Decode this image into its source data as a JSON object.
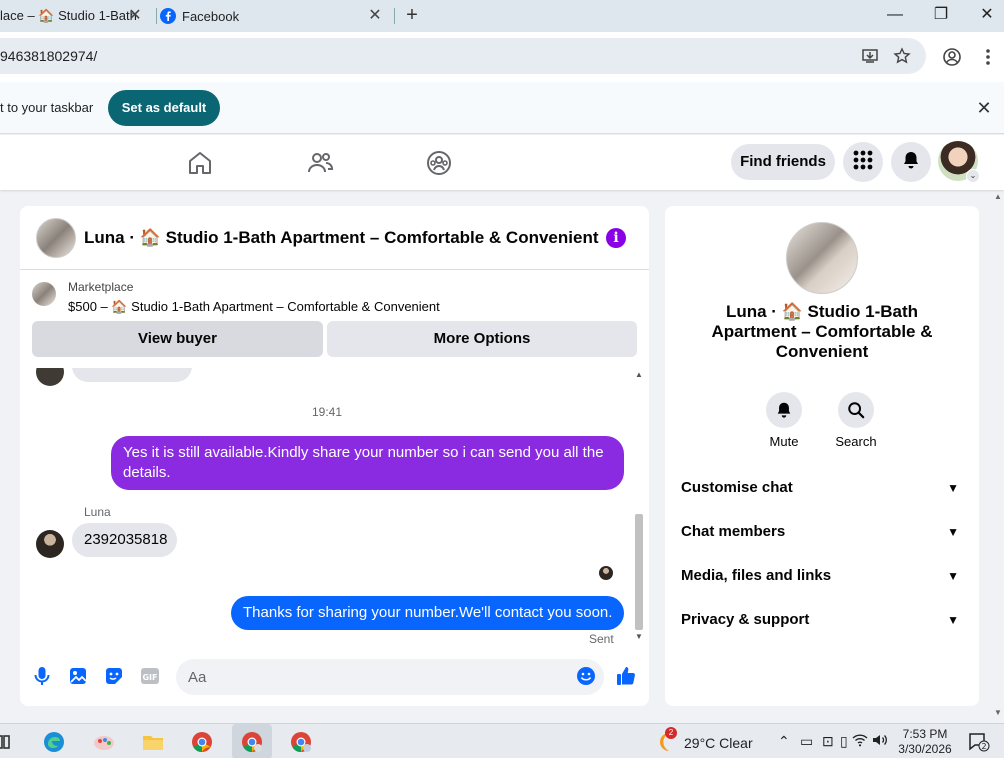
{
  "browser": {
    "tabs": [
      {
        "title": "lace – 🏠 Studio 1-Bath",
        "close": "✕"
      },
      {
        "title": "Facebook",
        "close": "✕"
      }
    ],
    "new_tab": "+",
    "url": "946381802974/"
  },
  "infobar": {
    "text": "t to your taskbar",
    "button": "Set as default",
    "close": "✕"
  },
  "nav": {
    "find_friends": "Find friends"
  },
  "chat": {
    "title": "Luna · 🏠 Studio 1-Bath Apartment – Comfortable & Convenient",
    "marketplace_label": "Marketplace",
    "listing": "$500 – 🏠 Studio 1-Bath Apartment – Comfortable & Convenient",
    "view_buyer": "View buyer",
    "more_options": "More Options",
    "timestamp": "19:41",
    "messages": [
      {
        "from": "me",
        "text": "Yes it is still available.Kindly share your number so i can send you all the details."
      },
      {
        "from": "Luna",
        "sender": "Luna",
        "text": "2392035818"
      },
      {
        "from": "me",
        "text": "Thanks for sharing your number.We'll contact you soon."
      }
    ],
    "sent_status": "Sent",
    "input_placeholder": "Aa"
  },
  "panel": {
    "title": "Luna · 🏠 Studio 1-Bath Apartment – Comfortable & Convenient",
    "actions": [
      {
        "label": "Mute",
        "icon": "bell-icon"
      },
      {
        "label": "Search",
        "icon": "search-icon"
      }
    ],
    "sections": [
      {
        "label": "Customise chat"
      },
      {
        "label": "Chat members"
      },
      {
        "label": "Media, files and links"
      },
      {
        "label": "Privacy & support"
      }
    ]
  },
  "taskbar": {
    "weather_badge": "2",
    "weather": "29°C  Clear",
    "time": "7:53 PM",
    "date": "3/30/2026",
    "notifications": "2"
  },
  "colors": {
    "accent_purple": "#8a2be2",
    "accent_blue": "#0866ff",
    "default_button": "#0b6673"
  }
}
